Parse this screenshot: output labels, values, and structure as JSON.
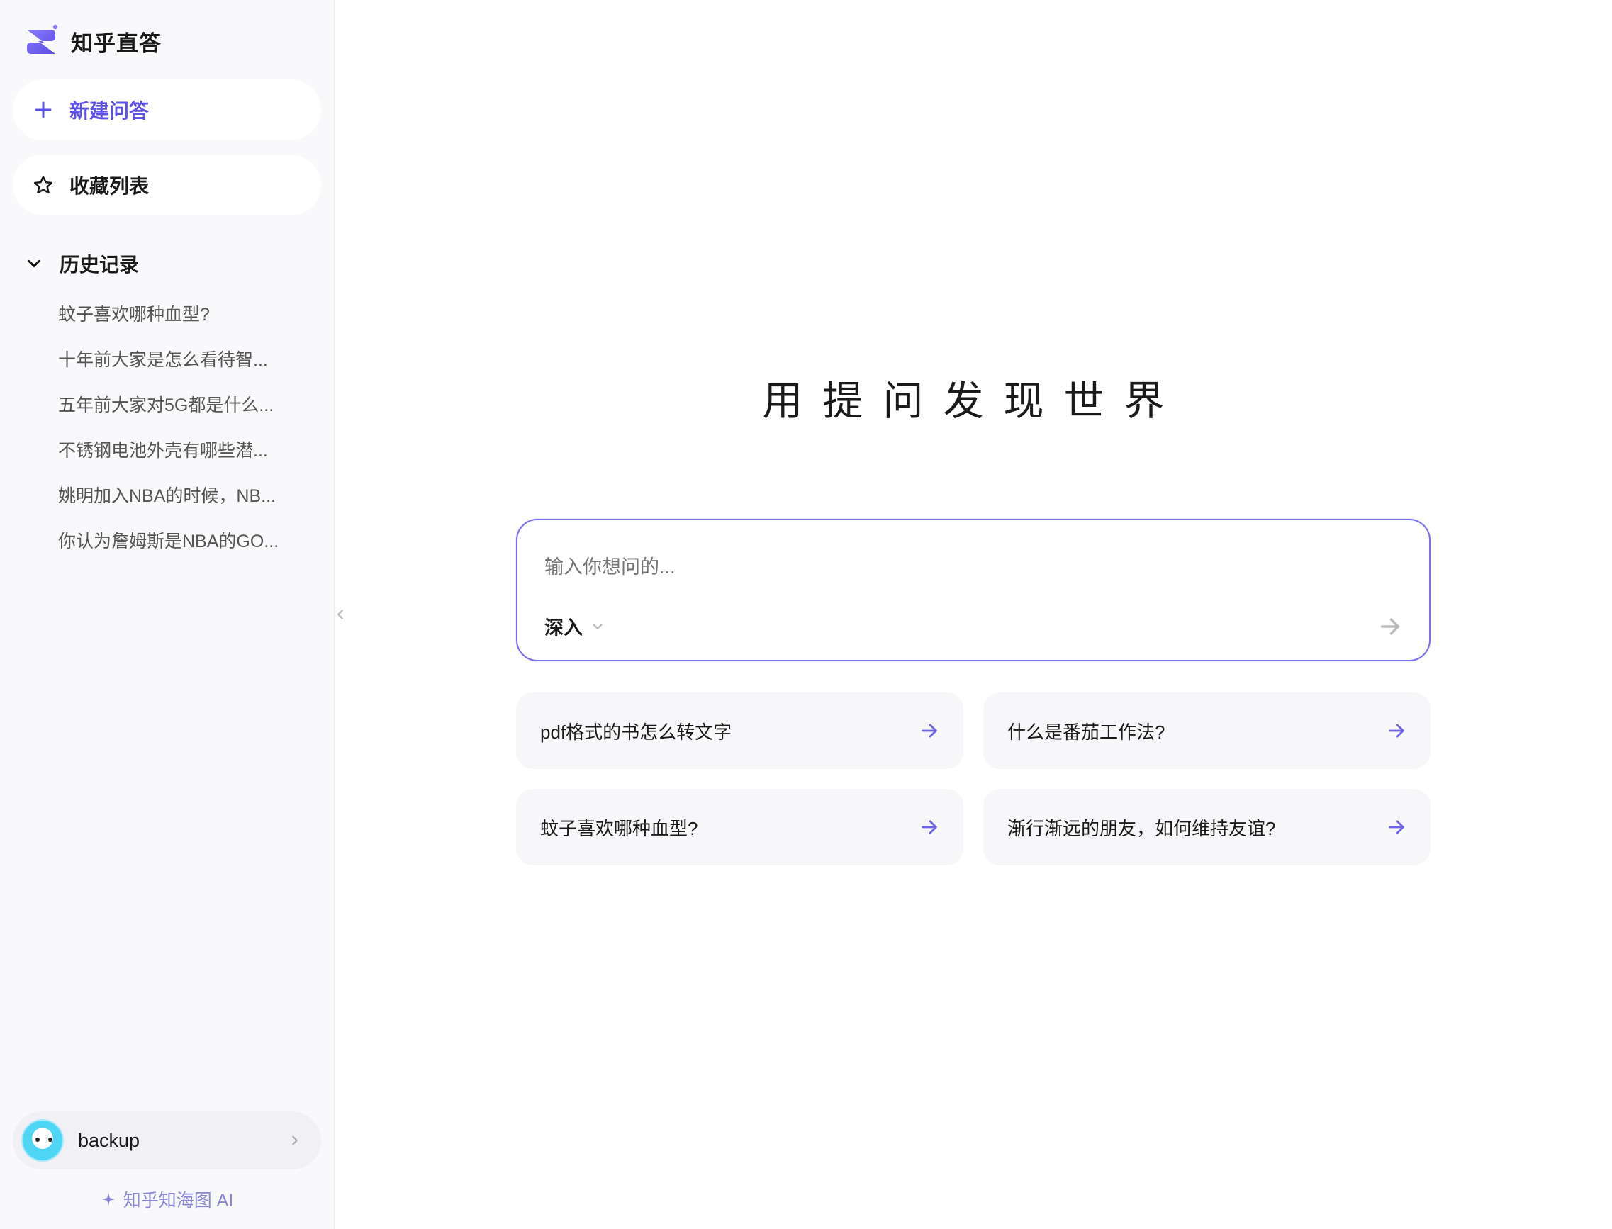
{
  "brand": {
    "name": "知乎直答"
  },
  "sidebar": {
    "new_label": "新建问答",
    "fav_label": "收藏列表",
    "history_label": "历史记录",
    "history": [
      "蚊子喜欢哪种血型?",
      "十年前大家是怎么看待智...",
      "五年前大家对5G都是什么...",
      "不锈钢电池外壳有哪些潜...",
      "姚明加入NBA的时候，NB...",
      "你认为詹姆斯是NBA的GO..."
    ],
    "user_name": "backup",
    "footer_link": "知乎知海图 AI"
  },
  "main": {
    "hero": "用提问发现世界",
    "placeholder": "输入你想问的...",
    "mode_label": "深入",
    "suggestions": [
      "pdf格式的书怎么转文字",
      "什么是番茄工作法?",
      "蚊子喜欢哪种血型?",
      "渐行渐远的朋友，如何维持友谊?"
    ]
  },
  "colors": {
    "accent": "#6e63ea"
  }
}
